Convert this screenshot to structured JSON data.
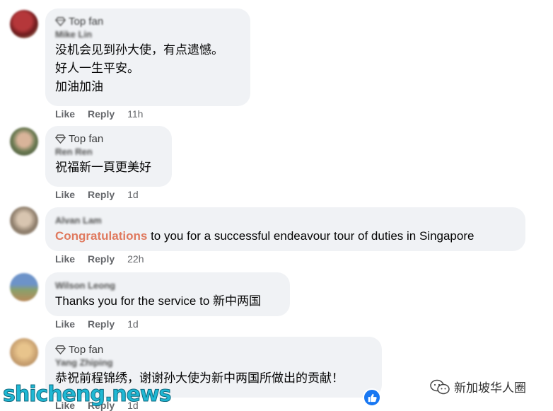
{
  "comments": [
    {
      "badge": "Top fan",
      "author": "Mike Lin",
      "text": "没机会见到孙大使，有点遗憾。\n好人一生平安。\n加油加油",
      "like": "Like",
      "reply": "Reply",
      "time": "11h"
    },
    {
      "badge": "Top fan",
      "author": "Ren Ren",
      "text": "祝福新一頁更美好",
      "like": "Like",
      "reply": "Reply",
      "time": "1d"
    },
    {
      "author": "Alvan Lam",
      "text_highlight": "Congratulations",
      "text_rest": " to you for a successful endeavour tour of duties in Singapore",
      "like": "Like",
      "reply": "Reply",
      "time": "22h"
    },
    {
      "author": "Wilson Leong",
      "text": "Thanks you for the service to 新中两国",
      "like": "Like",
      "reply": "Reply",
      "time": "1d"
    },
    {
      "badge": "Top fan",
      "author": "Yang Zhiping",
      "text": "恭祝前程锦绣，谢谢孙大使为新中两国所做出的贡献！",
      "like": "Like",
      "reply": "Reply",
      "time": "1d",
      "reaction_icon": "thumbs-up-icon"
    }
  ],
  "watermarks": {
    "site": "shicheng.news",
    "account": "新加坡华人圈"
  },
  "colors": {
    "bubble": "#f0f2f5",
    "highlight": "#e07a5f",
    "like_blue": "#1877f2",
    "meta_gray": "#65676b"
  }
}
